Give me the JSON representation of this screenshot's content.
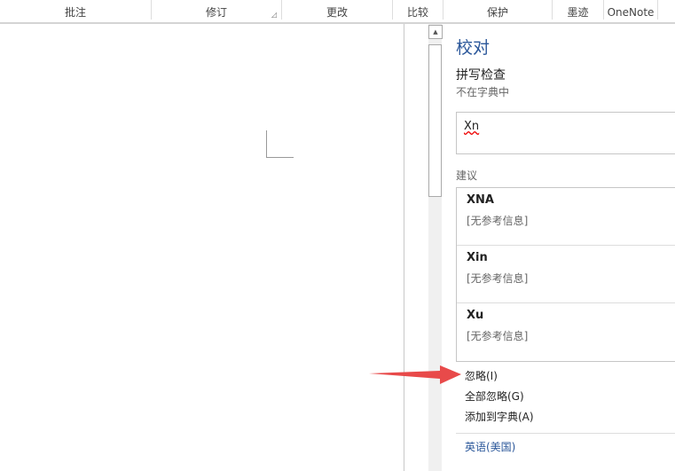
{
  "ribbon": {
    "groups": [
      "批注",
      "修订",
      "更改",
      "比较",
      "保护",
      "墨迹",
      "OneNote"
    ]
  },
  "pane": {
    "title": "校对",
    "section": "拼写检查",
    "status": "不在字典中",
    "word": "Xn",
    "suggestions_label": "建议",
    "suggestions": [
      {
        "word": "XNA",
        "info": "[无参考信息]"
      },
      {
        "word": "Xin",
        "info": "[无参考信息]"
      },
      {
        "word": "Xu",
        "info": "[无参考信息]"
      }
    ],
    "ignore": "忽略(I)",
    "ignore_all": "全部忽略(G)",
    "add_to_dictionary": "添加到字典(A)",
    "language": "英语(美国)"
  },
  "colors": {
    "accent": "#2b579a",
    "arrow": "#e84a4a"
  }
}
